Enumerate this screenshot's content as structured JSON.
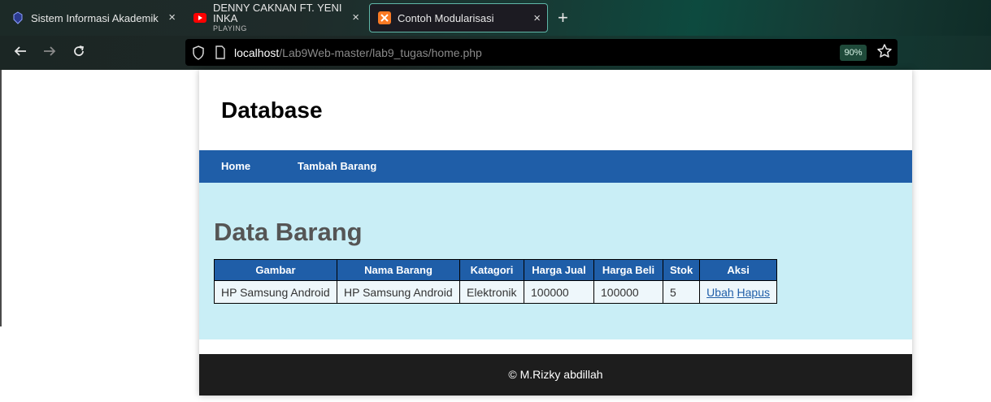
{
  "browser": {
    "tabs": [
      {
        "title": "Sistem Informasi Akademik",
        "close": "×"
      },
      {
        "title": "DENNY CAKNAN FT. YENI INKA",
        "subtitle": "PLAYING",
        "close": "×"
      },
      {
        "title": "Contoh Modularisasi",
        "close": "×"
      }
    ],
    "new_tab": "+",
    "url_host": "localhost",
    "url_path": "/Lab9Web-master/lab9_tugas/home.php",
    "zoom": "90%",
    "icons": {
      "back": "arrow-left-icon",
      "forward": "arrow-right-icon",
      "reload": "reload-icon",
      "bookmark": "star-icon"
    },
    "colors": {
      "tab_active_border": "#5fb7a8",
      "zoom_badge": "#1f4a3a"
    }
  },
  "page": {
    "site_title": "Database",
    "menu": [
      "Home",
      "Tambah Barang"
    ],
    "heading": "Data Barang",
    "table": {
      "headers": [
        "Gambar",
        "Nama Barang",
        "Katagori",
        "Harga Jual",
        "Harga Beli",
        "Stok",
        "Aksi"
      ],
      "rows": [
        {
          "gambar": "HP Samsung Android",
          "nama": "HP Samsung Android",
          "kategori": "Elektronik",
          "harga_jual": "100000",
          "harga_beli": "100000",
          "stok": "5",
          "aksi": [
            "Ubah",
            "Hapus"
          ]
        }
      ]
    },
    "footer": "© M.Rizky abdillah",
    "colors": {
      "primary": "#1f5ea8",
      "content_bg": "#c9eef6",
      "footer_bg": "#1d1d1d"
    }
  }
}
